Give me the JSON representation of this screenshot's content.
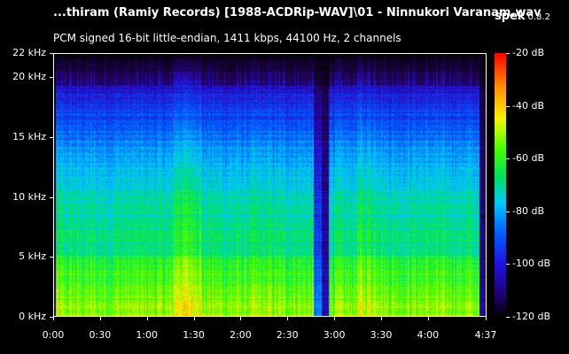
{
  "window": {
    "file_title": "...thiram (Ramiy Records) [1988-ACDRip-WAV]\\01 - Ninnukori Varanam.wav",
    "app_name": "spek",
    "app_version": "0.8.2",
    "stream_info": "PCM signed 16-bit little-endian, 1411 kbps, 44100 Hz, 2 channels"
  },
  "frequency_axis": {
    "labels": [
      "22 kHz",
      "20 kHz",
      "15 kHz",
      "10 kHz",
      "5 kHz",
      "0 kHz"
    ],
    "values_khz": [
      22,
      20,
      15,
      10,
      5,
      0
    ]
  },
  "time_axis": {
    "labels": [
      "0:00",
      "0:30",
      "1:00",
      "1:30",
      "2:00",
      "2:30",
      "3:00",
      "3:30",
      "4:00",
      "4:37"
    ],
    "values_sec": [
      0,
      30,
      60,
      90,
      120,
      150,
      180,
      210,
      240,
      277
    ]
  },
  "colorbar": {
    "labels": [
      "-20 dB",
      "-40 dB",
      "-60 dB",
      "-80 dB",
      "-100 dB",
      "-120 dB"
    ],
    "values_db": [
      -20,
      -40,
      -60,
      -80,
      -100,
      -120
    ]
  }
}
